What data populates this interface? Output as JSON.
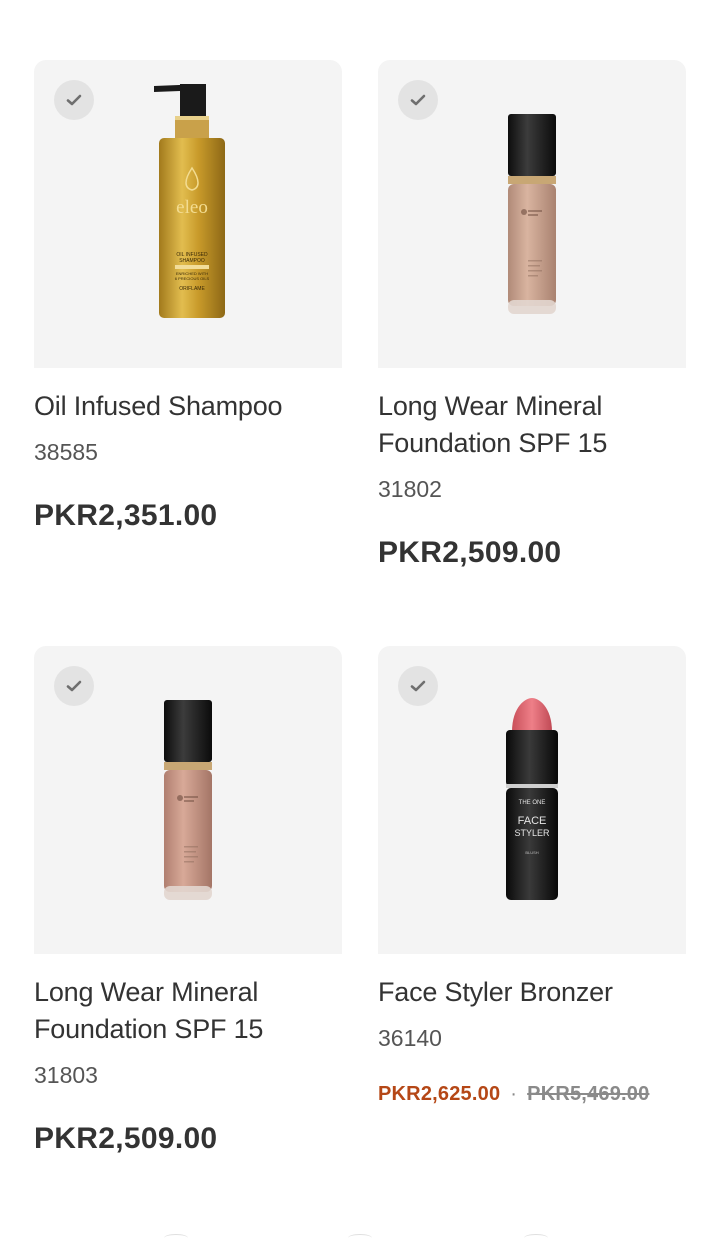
{
  "products": [
    {
      "name": "Oil Infused Shampoo",
      "code": "38585",
      "price": "PKR2,351.00",
      "image_text": {
        "brand": "eleo",
        "line1": "OIL INFUSED",
        "line2": "SHAMPOO",
        "line3": "ENRICHED WITH",
        "line4": "6 PRECIOUS OILS",
        "maker": "ORIFLAME"
      }
    },
    {
      "name": "Long Wear Mineral Foundation SPF 15",
      "code": "31802",
      "price": "PKR2,509.00"
    },
    {
      "name": "Long Wear Mineral Foundation SPF 15",
      "code": "31803",
      "price": "PKR2,509.00"
    },
    {
      "name": "Face Styler Bronzer",
      "code": "36140",
      "sale_price": "PKR2,625.00",
      "separator": "·",
      "old_price": "PKR5,469.00",
      "image_text": {
        "brand": "THE ONE",
        "line1": "FACE",
        "line2": "STYLER",
        "line3": "BLUSH"
      }
    }
  ],
  "colors": {
    "card_bg": "#f4f4f4",
    "sale_price": "#b54716",
    "text": "#333333"
  },
  "icons": {
    "select": "check-icon"
  }
}
